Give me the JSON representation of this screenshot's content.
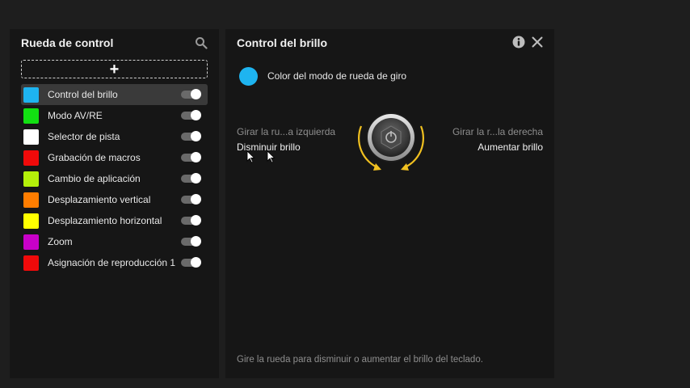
{
  "left_panel": {
    "title": "Rueda de control",
    "add_symbol": "+",
    "items": [
      {
        "label": "Control del brillo",
        "color": "#1eb4f0",
        "enabled": true,
        "selected": true
      },
      {
        "label": "Modo AV/RE",
        "color": "#12e012",
        "enabled": true,
        "selected": false
      },
      {
        "label": "Selector de pista",
        "color": "#ffffff",
        "enabled": true,
        "selected": false
      },
      {
        "label": "Grabación de macros",
        "color": "#f00a0a",
        "enabled": true,
        "selected": false
      },
      {
        "label": "Cambio de aplicación",
        "color": "#b4f00a",
        "enabled": true,
        "selected": false
      },
      {
        "label": "Desplazamiento vertical",
        "color": "#ff7d00",
        "enabled": true,
        "selected": false
      },
      {
        "label": "Desplazamiento horizontal",
        "color": "#ffff00",
        "enabled": true,
        "selected": false
      },
      {
        "label": "Zoom",
        "color": "#c800c8",
        "enabled": true,
        "selected": false
      },
      {
        "label": "Asignación de reproducción 1",
        "color": "#f00a0a",
        "enabled": true,
        "selected": false
      }
    ]
  },
  "right_panel": {
    "title": "Control del brillo",
    "mode_label": "Color del modo de rueda de giro",
    "mode_color": "#1eb4f0",
    "left_hint": "Girar la ru...a izquierda",
    "left_action": "Disminuir brillo",
    "right_hint": "Girar la r...la derecha",
    "right_action": "Aumentar brillo",
    "footer": "Gire la rueda para disminuir o aumentar el brillo del teclado."
  },
  "colors": {
    "background": "#1e1e1e",
    "panel": "#161616",
    "accent_arrow": "#f0c020"
  }
}
